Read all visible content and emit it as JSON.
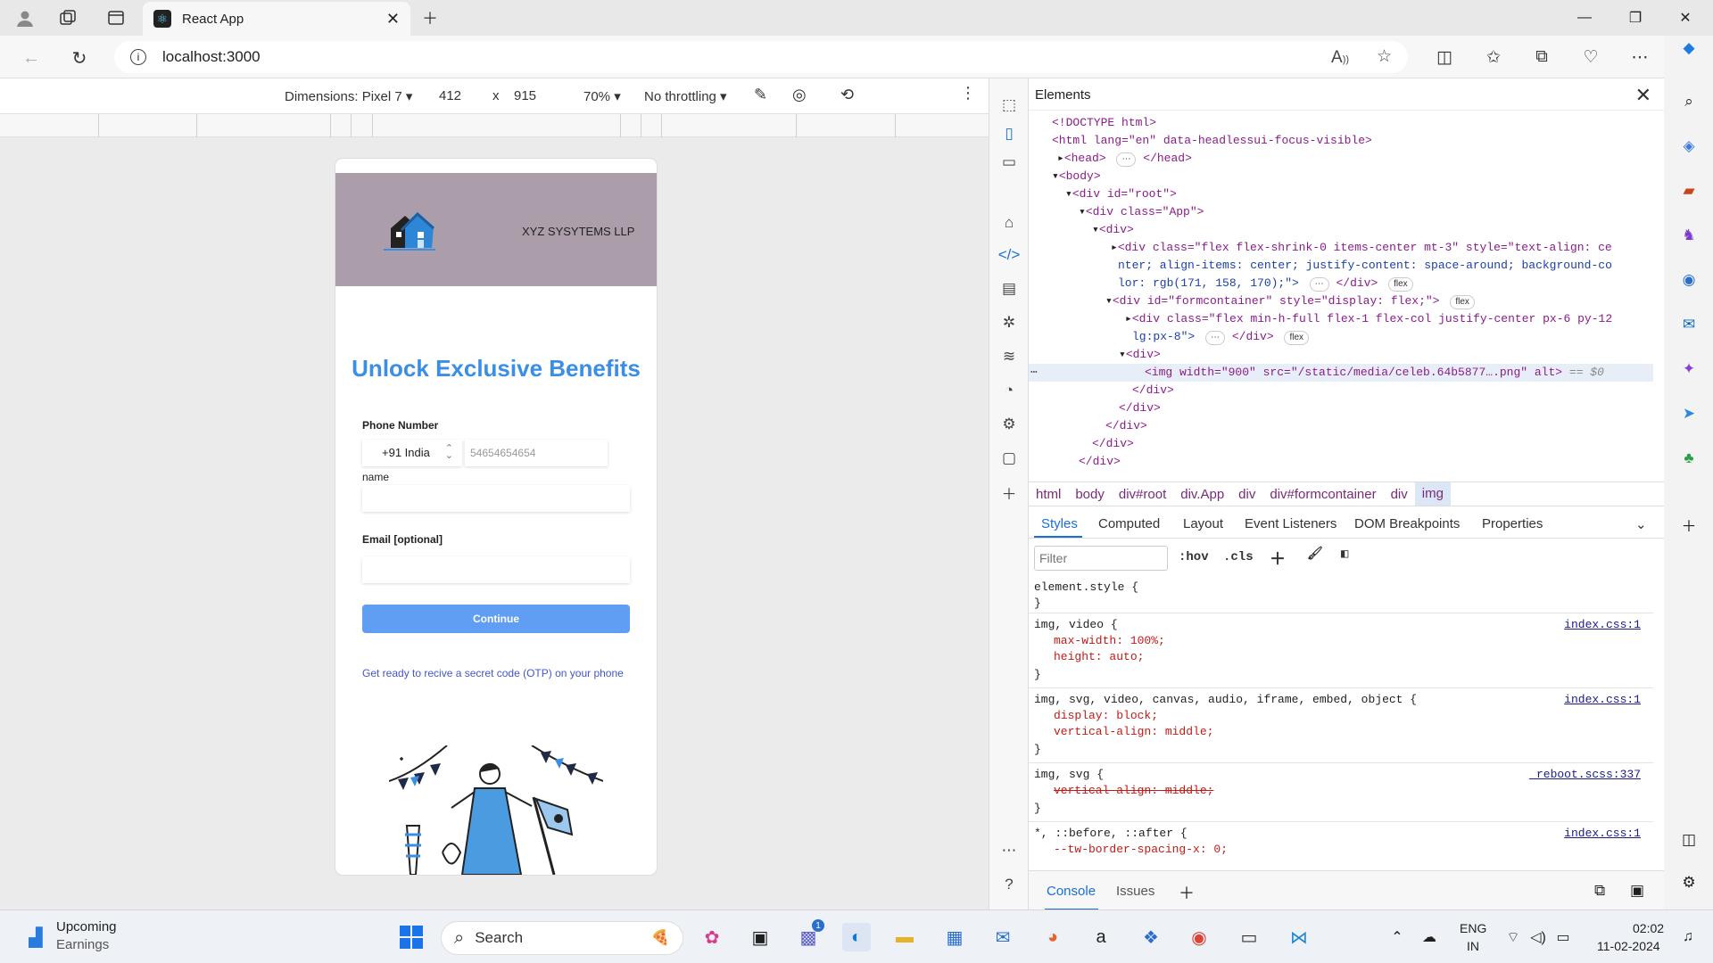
{
  "browser": {
    "tab_title": "React App",
    "url": "localhost:3000"
  },
  "device_toolbar": {
    "dimensions_label": "Dimensions: Pixel 7",
    "width": "412",
    "times": "x",
    "height": "915",
    "zoom": "70%",
    "throttling": "No throttling"
  },
  "page": {
    "company": "XYZ SYSYTEMS LLP",
    "headline": "Unlock Exclusive Benefits",
    "phone_label": "Phone Number",
    "country_value": "+91 India",
    "phone_placeholder": "54654654654",
    "name_label": "name",
    "email_label": "Email [optional]",
    "continue_label": "Continue",
    "otp_note": "Get ready to recive a secret code (OTP) on your phone"
  },
  "devtools": {
    "panel_title": "Elements",
    "dom": [
      "<!DOCTYPE html>",
      "<html lang=\"en\" data-headlessui-focus-visible>",
      "<head>",
      "</head>",
      "<body>",
      "<div id=\"root\">",
      "<div class=\"App\">",
      "<div>",
      "<div class=\"flex flex-shrink-0 items-center mt-3\" style=\"text-align: ce",
      "nter; align-items: center; justify-content: space-around; background-co",
      "lor: rgb(171, 158, 170);\">",
      "</div>",
      "<div id=\"formcontainer\" style=\"display: flex;\">",
      "<div class=\"flex min-h-full flex-1 flex-col justify-center px-6 py-12",
      "lg:px-8\">",
      "</div>",
      "<div>",
      "<img width=\"900\" src=\"/static/media/celeb.64b5877….png\" alt>",
      "== $0",
      "</div>",
      "</div>",
      "</div>",
      "</div>",
      "</div>",
      "flex"
    ],
    "breadcrumbs": [
      "html",
      "body",
      "div#root",
      "div.App",
      "div",
      "div#formcontainer",
      "div",
      "img"
    ],
    "style_tabs": [
      "Styles",
      "Computed",
      "Layout",
      "Event Listeners",
      "DOM Breakpoints",
      "Properties"
    ],
    "filter_placeholder": "Filter",
    "hov": ":hov",
    "cls": ".cls",
    "rules": [
      {
        "selector": "element.style {",
        "source": "",
        "props": []
      },
      {
        "selector": "img, video {",
        "source": "index.css:1",
        "props": [
          "max-width: 100%;",
          "height: auto;"
        ]
      },
      {
        "selector": "img, svg, video, canvas, audio, iframe, embed, object {",
        "source": "index.css:1",
        "props": [
          "display: block;",
          "vertical-align: middle;"
        ]
      },
      {
        "selector": "img, svg {",
        "source": "_reboot.scss:337",
        "props": [
          "vertical-align: middle;"
        ]
      },
      {
        "selector": "*, ::before, ::after {",
        "source": "index.css:1",
        "props": [
          "--tw-border-spacing-x: 0;"
        ]
      }
    ],
    "close_brace": "}",
    "console_tab": "Console",
    "issues_tab": "Issues"
  },
  "taskbar": {
    "weather_title": "Upcoming",
    "weather_sub": "Earnings",
    "search_label": "Search",
    "lang_top": "ENG",
    "lang_bottom": "IN",
    "time": "02:02",
    "date": "11-02-2024",
    "teams_badge": "1"
  },
  "colors": {
    "header_bg": "#ab9eaa",
    "headline": "#3a8ee6",
    "continue_bg": "#5f9ef3"
  }
}
